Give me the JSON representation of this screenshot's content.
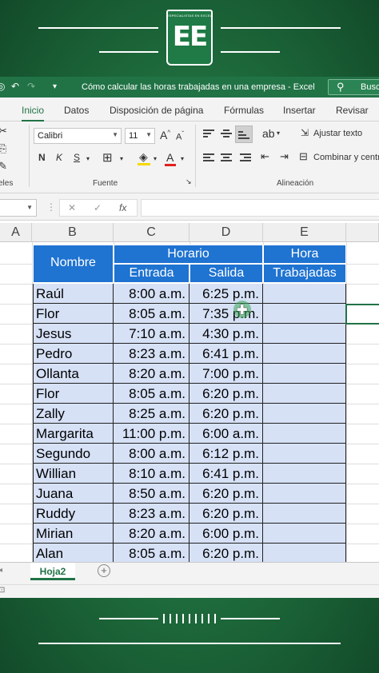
{
  "brand": {
    "logo_caption": "ESPECIALISTAS EN EXCEL",
    "logo_mark": "EE"
  },
  "window": {
    "title": "Cómo calcular las horas trabajadas en una empresa  -  Excel",
    "search_label": "Busc",
    "accent_color": "#217346"
  },
  "tabs": [
    "Inicio",
    "Datos",
    "Disposición de página",
    "Fórmulas",
    "Insertar",
    "Revisar"
  ],
  "ribbon": {
    "font_name": "Calibri",
    "font_size": "11",
    "wrap_text": "Ajustar texto",
    "merge_center": "Combinar y centr",
    "group_font": "Fuente",
    "group_align": "Alineación",
    "group_clipboard": "eles"
  },
  "formula_bar": {
    "fx": "fx"
  },
  "columns": [
    "A",
    "B",
    "C",
    "D",
    "E"
  ],
  "table": {
    "header_nombre": "Nombre",
    "header_horario": "Horario",
    "header_entrada": "Entrada",
    "header_salida": "Salida",
    "header_hora": "Hora",
    "header_trabajadas": "Trabajadas",
    "header_color": "#1f73d1",
    "row_color": "#d6e1f6",
    "rows": [
      {
        "nombre": "Raúl",
        "entrada": "8:00 a.m.",
        "salida": "6:25 p.m."
      },
      {
        "nombre": "Flor",
        "entrada": "8:05 a.m.",
        "salida": "7:35 p.m."
      },
      {
        "nombre": "Jesus",
        "entrada": "7:10 a.m.",
        "salida": "4:30 p.m."
      },
      {
        "nombre": "Pedro",
        "entrada": "8:23 a.m.",
        "salida": "6:41 p.m."
      },
      {
        "nombre": "Ollanta",
        "entrada": "8:20 a.m.",
        "salida": "7:00 p.m."
      },
      {
        "nombre": "Flor",
        "entrada": "8:05 a.m.",
        "salida": "6:20 p.m."
      },
      {
        "nombre": "Zally",
        "entrada": "8:25 a.m.",
        "salida": "6:20 p.m."
      },
      {
        "nombre": "Margarita",
        "entrada": "11:00 p.m.",
        "salida": "6:00 a.m."
      },
      {
        "nombre": "Segundo",
        "entrada": "8:00 a.m.",
        "salida": "6:12 p.m."
      },
      {
        "nombre": "Willian",
        "entrada": "8:10 a.m.",
        "salida": "6:41 p.m."
      },
      {
        "nombre": "Juana",
        "entrada": "8:50 a.m.",
        "salida": "6:20 p.m."
      },
      {
        "nombre": "Ruddy",
        "entrada": "8:23 a.m.",
        "salida": "6:20 p.m."
      },
      {
        "nombre": "Mirian",
        "entrada": "8:20 a.m.",
        "salida": "6:00 p.m."
      },
      {
        "nombre": "Alan",
        "entrada": "8:05 a.m.",
        "salida": "6:20 p.m."
      }
    ]
  },
  "sheets": {
    "active": "Hoja2",
    "add_icon": "add-sheet-icon"
  }
}
